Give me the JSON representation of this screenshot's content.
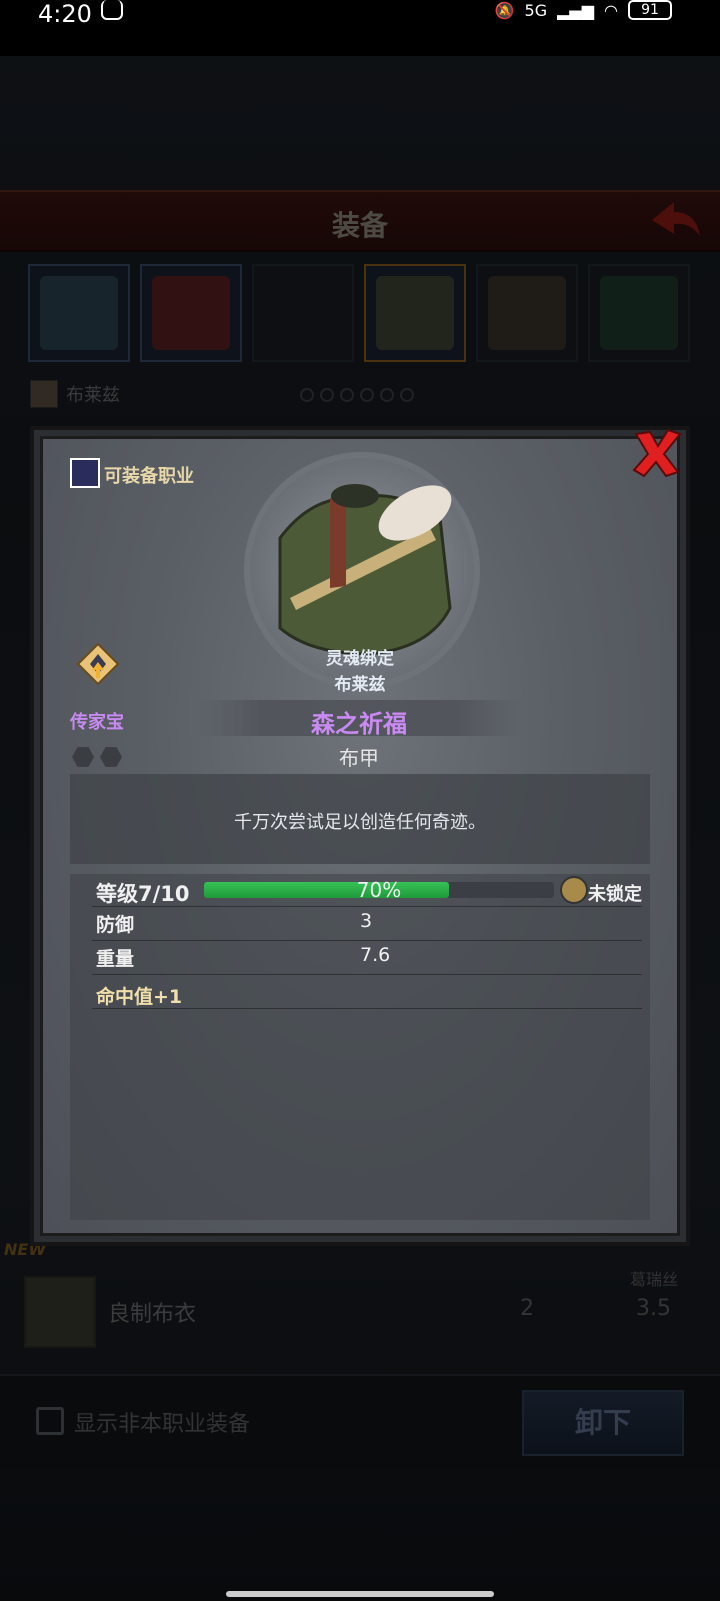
{
  "status_bar": {
    "time": "4:20",
    "network": "5G",
    "battery": "91"
  },
  "screen": {
    "title": "装备",
    "character_name": "布莱兹",
    "bg_list": {
      "new_tag": "NEW",
      "item_name": "良制布衣",
      "value1": "2",
      "value2": "3.5",
      "owner": "葛瑞丝"
    },
    "show_non_class_label": "显示非本职业装备",
    "unequip_label": "卸下"
  },
  "modal": {
    "class_label": "可装备职业",
    "heirloom_label": "传家宝",
    "soulbound_label": "灵魂绑定",
    "soulbound_owner": "布莱兹",
    "item_name": "森之祈福",
    "item_type": "布甲",
    "description": "千万次尝试足以创造任何奇迹。",
    "level_label": "等级7/10",
    "progress_percent": 70,
    "progress_text": "70%",
    "lock_label": "未锁定",
    "stats": [
      {
        "name": "防御",
        "value": "3"
      },
      {
        "name": "重量",
        "value": "7.6"
      }
    ],
    "bonus": "命中值+1",
    "colors": {
      "epic_purple": "#c98af2",
      "progress_green": "#37c156",
      "close_red": "#e02020"
    }
  }
}
